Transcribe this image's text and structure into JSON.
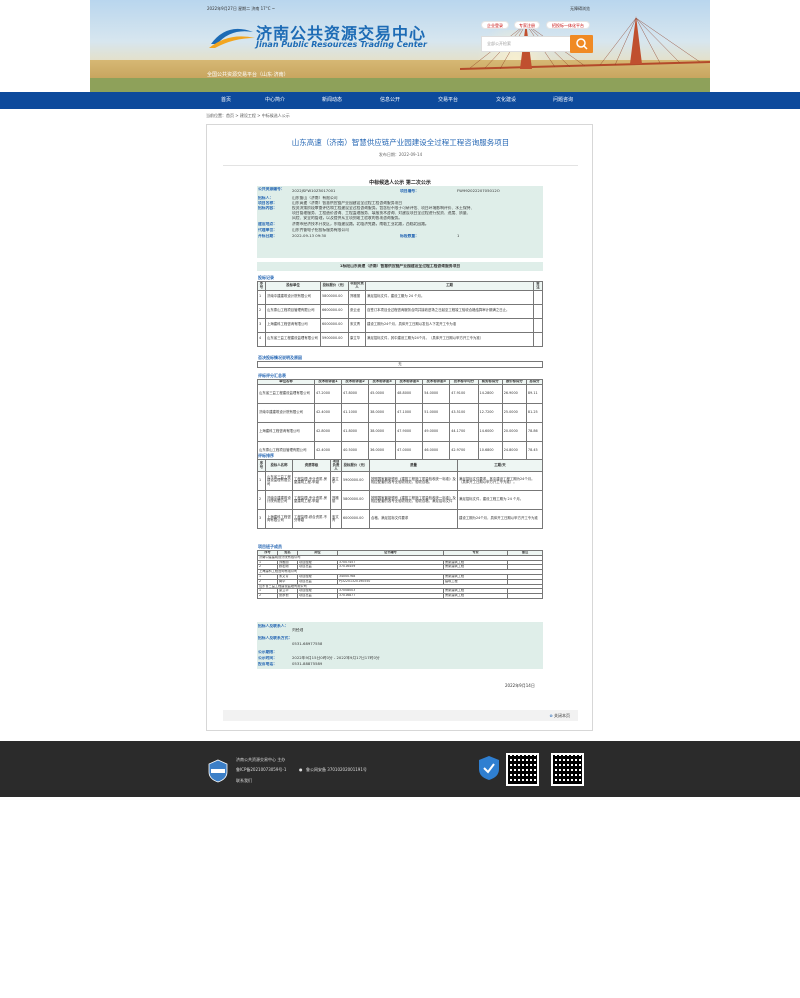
{
  "header": {
    "date_line": "2022年9月27日 星期二 济南 17°C ~",
    "shortcut": "无障碍浏览",
    "site_title": "济南公共资源交易中心",
    "site_title_en": "Jinan Public Resources Trading Center",
    "platform": "全国公共资源交易平台（山东·济南）",
    "pills": [
      "企业登录",
      "专家注册",
      "招投标一体化平台"
    ],
    "search_placeholder": "全部公开检索"
  },
  "nav": [
    "首页",
    "中心简介",
    "新闻动态",
    "信息公开",
    "交易平台",
    "文化建设",
    "问题咨询"
  ],
  "breadcrumb": "当前位置：首页 > 建设工程 > 中标候选人公示",
  "article": {
    "title": "山东高速（济南）智慧供应链产业园建设全过程工程咨询服务项目",
    "publish_time": "发布日期：2022-09-14",
    "heading": "中标候选人公示 第二次公示",
    "fields": [
      {
        "label": "公共资源编号：",
        "value": "2022JSFW10Z5017001",
        "label2": "项目编号：",
        "value2": "FW99202220705012O"
      },
      {
        "label": "招标人：",
        "value": "山东鲁山（济南）有限公司"
      },
      {
        "label": "项目名称：",
        "value": "山东高速（济南）智慧供应链产业园建设全过程工程咨询服务项目"
      },
      {
        "label": "招标内容：",
        "value": "投资决策阶段审查评估和工程建设全过程咨询服务。包含但不限于可研评估、项目环境影响评价、水土保持、"
      },
      {
        "label": "",
        "value": "项目管理服务、工程造价咨询、工程监理服务、填报技术咨询、对建设项目全过程进行投资、进度、质量、"
      },
      {
        "label": "",
        "value": "风险、安全的管理，以及提供从立项到竣工验收的各项咨询服务。"
      },
      {
        "label": "建设地点：",
        "value": "济南市经济技术开发区，东临建设路，北临济兖路，南临工业北路，西临北园路。"
      },
      {
        "label": "代理单位：",
        "value": "山东齐鲁电子招投标服务有限公司"
      },
      {
        "label": "开标日期：",
        "value": "2022-09-13 09:30",
        "label2": "标段数量：",
        "value2": "1"
      }
    ],
    "section_title": "1标段山东高速（济南）智慧供应链产业园建设全过程工程咨询服务项目",
    "s1": "投标记录",
    "s1_head": [
      "序号",
      "投标单位",
      "投标报价（元）",
      "项目负责人",
      "工期",
      "备注"
    ],
    "s1_rows": [
      [
        "1",
        "济南中建建筑设计院有限公司",
        "5800000.00",
        "郑雅丽",
        "满足招标文件，建设工期为 24 个月。",
        ""
      ],
      [
        "2",
        "山东泰山工程项目管理有限公司",
        "6600000.00",
        "张云龙",
        "自签订本项目全过程咨询服务合同并接收进场之日起至工程竣工验收合格结算审计期满之日止。",
        ""
      ],
      [
        "3",
        "上海建科工程咨询有限公司",
        "6000000.00",
        "宋文青",
        "建设工期为24个月，具体开工日期以发包人下发开工令为准",
        ""
      ],
      [
        "4",
        "山东省三益工程建设监理有限公司",
        "5900000.00",
        "康立华",
        "满足招标文件，其中建设工期为24个月。（具体开工日期以甲方开工令为准）",
        ""
      ]
    ],
    "s2": "否决投标情况说明及原因",
    "s2_value": "无",
    "s3": "评标评分汇总表",
    "s3_head": [
      "单位名称",
      "技术标评委1",
      "技术标评委2",
      "技术标评委3",
      "技术标评委4",
      "技术标评委5",
      "技术标平均分",
      "商务标得分",
      "报价标得分",
      "总得分"
    ],
    "s3_rows": [
      [
        "山东省三益工程建设监理有限公司",
        "47.2000",
        "47.8000",
        "45.0000",
        "48.8000",
        "54.0000",
        "47.9100",
        "14.2800",
        "26.9000",
        "89.11"
      ],
      [
        "济南中建建筑设计院有限公司",
        "42.4000",
        "41.1000",
        "38.0000",
        "47.1000",
        "51.0000",
        "43.5100",
        "12.7200",
        "25.0000",
        "81.25"
      ],
      [
        "上海建科工程咨询有限公司",
        "42.8000",
        "41.8000",
        "38.0000",
        "47.9000",
        "49.0000",
        "44.1700",
        "14.6000",
        "20.0000",
        "78.86"
      ],
      [
        "山东泰山工程项目管理有限公司",
        "42.4000",
        "40.5000",
        "36.0000",
        "47.0000",
        "46.0000",
        "42.9700",
        "10.6800",
        "24.8000",
        "78.45"
      ]
    ],
    "s4": "评标排序",
    "s4_head": [
      "序号",
      "投标人名称",
      "资质等级",
      "项目负责人",
      "投标报价（元）",
      "质量",
      "工期/天"
    ],
    "s4_rows": [
      [
        "1",
        "山东省三益工程建设监理有限公司",
        "工程监理-专业资质-房屋建筑工程-甲级",
        "康立华",
        "5900000.00",
        "按照国家最新颁布《建筑工程施工质量验收统一标准》及相应配套的各专业验收规范，验收合格。",
        "满足招标文件要求，其中建设工程工期为24个月。（具体开工日期以甲方开工令为准）。"
      ],
      [
        "2",
        "济南中建建筑设计院有限公司",
        "工程监理-专业资质-房屋建筑工程-甲级",
        "郑雅丽",
        "5800000.00",
        "按照国家最新颁布《建筑工程施工质量验收统一标准》及相应配套的各专业验收规范，验收合格，满足招标文件",
        "满足招标文件，建设工程工期为 24 个月。"
      ],
      [
        "3",
        "上海建科工程咨询有限公司",
        "工程监理-综合资质-不分等级",
        "宋文青",
        "6000000.00",
        "合格，满足招标文件要求",
        "建设工期为24个月，具体开工日期以甲方开工令为准"
      ]
    ],
    "s5": "项目班子成员",
    "s5_head": [
      "序号",
      "姓名",
      "岗位",
      "证书编号",
      "专业",
      "备注"
    ],
    "s5_groups": [
      {
        "name": "济南中建建筑设计院有限公司",
        "rows": [
          [
            "1",
            "郑雅丽",
            "项目经理",
            "37007457",
            "房屋建筑工程",
            ""
          ],
          [
            "2",
            "顾宏刚",
            "项目总监",
            "37016459",
            "房屋建筑工程",
            ""
          ]
        ]
      },
      {
        "name": "上海建科工程咨询有限公司",
        "rows": [
          [
            "1",
            "宋文青",
            "项目经理",
            "34000768",
            "房屋建筑工程",
            ""
          ],
          [
            "2",
            "蒋华",
            "项目总监",
            "PJ32201320190550",
            "建筑工程",
            ""
          ]
        ]
      },
      {
        "name": "山东省三益工程建设监理有限公司",
        "rows": [
          [
            "1",
            "康立华",
            "项目经理",
            "37008003",
            "房屋建筑工程",
            ""
          ],
          [
            "2",
            "张永祯",
            "项目总监",
            "37016877",
            "房屋建筑工程",
            ""
          ]
        ]
      }
    ],
    "footer_fields": [
      {
        "label": "招标人及联系人：",
        "value": "刘经理"
      },
      {
        "label": "招标人及联系方式：",
        "value": "0531-68977558"
      },
      {
        "label": "公示期限：",
        "value": ""
      },
      {
        "label": "公示时间：",
        "value": "2022年9月15日0时0分 - 2022年9月17日17时0分"
      },
      {
        "label": "投诉电话：",
        "value": "0531-88875589"
      }
    ],
    "sign_date": "2022年9月14日",
    "close": "关闭本页"
  },
  "footer": {
    "host": "济南公共资源交易中心 主办",
    "icp": "鲁ICP备20210073059号-1",
    "police": "鲁公网安备 37010202001191号",
    "contact": "联系我们"
  },
  "colors": {
    "nav": "#0d4a9c",
    "title": "#2667b4",
    "box": "#dfeee9",
    "footer": "#2b2b2b",
    "search_btn": "#f08a24"
  }
}
